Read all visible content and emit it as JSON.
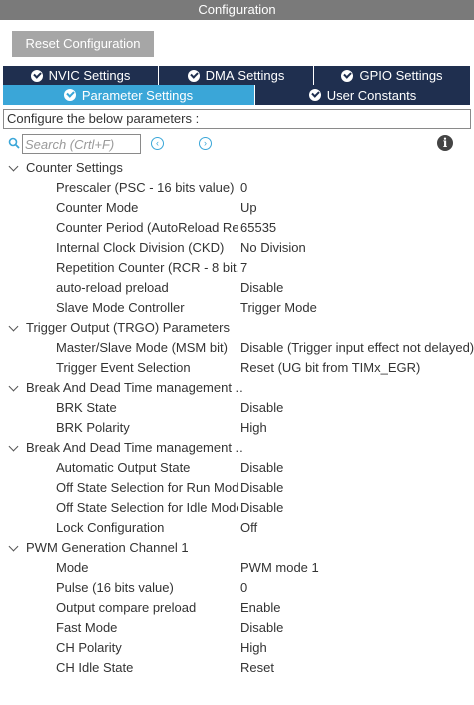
{
  "window": {
    "title": "Configuration"
  },
  "toolbar": {
    "reset_label": "Reset Configuration"
  },
  "tabs_row1": [
    {
      "label": "NVIC Settings"
    },
    {
      "label": "DMA Settings"
    },
    {
      "label": "GPIO Settings"
    }
  ],
  "tabs_row2": [
    {
      "label": "Parameter Settings",
      "active": true
    },
    {
      "label": "User Constants"
    }
  ],
  "config_hint": "Configure the below parameters :",
  "search": {
    "placeholder": "Search (Crtl+F)"
  },
  "colors": {
    "tab_dark": "#1f2f4f",
    "tab_active": "#3aa6d8",
    "title_bar": "#7a7a7a"
  },
  "groups": [
    {
      "title": "Counter Settings",
      "params": [
        {
          "name": "Prescaler (PSC - 16 bits value)",
          "value": "0"
        },
        {
          "name": "Counter Mode",
          "value": "Up"
        },
        {
          "name": "Counter Period (AutoReload Re.",
          "value": "65535"
        },
        {
          "name": "Internal Clock Division (CKD)",
          "value": "No Division"
        },
        {
          "name": "Repetition Counter (RCR - 8 bit...",
          "value": "7"
        },
        {
          "name": "auto-reload preload",
          "value": "Disable"
        },
        {
          "name": "Slave Mode Controller",
          "value": "Trigger Mode"
        }
      ]
    },
    {
      "title": "Trigger Output (TRGO) Parameters",
      "params": [
        {
          "name": "Master/Slave Mode (MSM bit)",
          "value": "Disable (Trigger input effect not delayed)"
        },
        {
          "name": "Trigger Event Selection",
          "value": "Reset (UG bit from TIMx_EGR)"
        }
      ]
    },
    {
      "title": "Break And Dead Time management ..",
      "params": [
        {
          "name": "BRK State",
          "value": "Disable"
        },
        {
          "name": "BRK Polarity",
          "value": "High"
        }
      ]
    },
    {
      "title": "Break And Dead Time management ..",
      "params": [
        {
          "name": "Automatic Output State",
          "value": "Disable"
        },
        {
          "name": "Off State Selection for Run Mod..",
          "value": "Disable"
        },
        {
          "name": "Off State Selection for Idle Mode..",
          "value": "Disable"
        },
        {
          "name": "Lock Configuration",
          "value": "Off"
        }
      ]
    },
    {
      "title": "PWM Generation Channel 1",
      "params": [
        {
          "name": "Mode",
          "value": "PWM mode 1"
        },
        {
          "name": "Pulse (16 bits value)",
          "value": "0"
        },
        {
          "name": "Output compare preload",
          "value": "Enable"
        },
        {
          "name": "Fast Mode",
          "value": "Disable"
        },
        {
          "name": "CH Polarity",
          "value": "High"
        },
        {
          "name": "CH Idle State",
          "value": "Reset"
        }
      ]
    }
  ]
}
